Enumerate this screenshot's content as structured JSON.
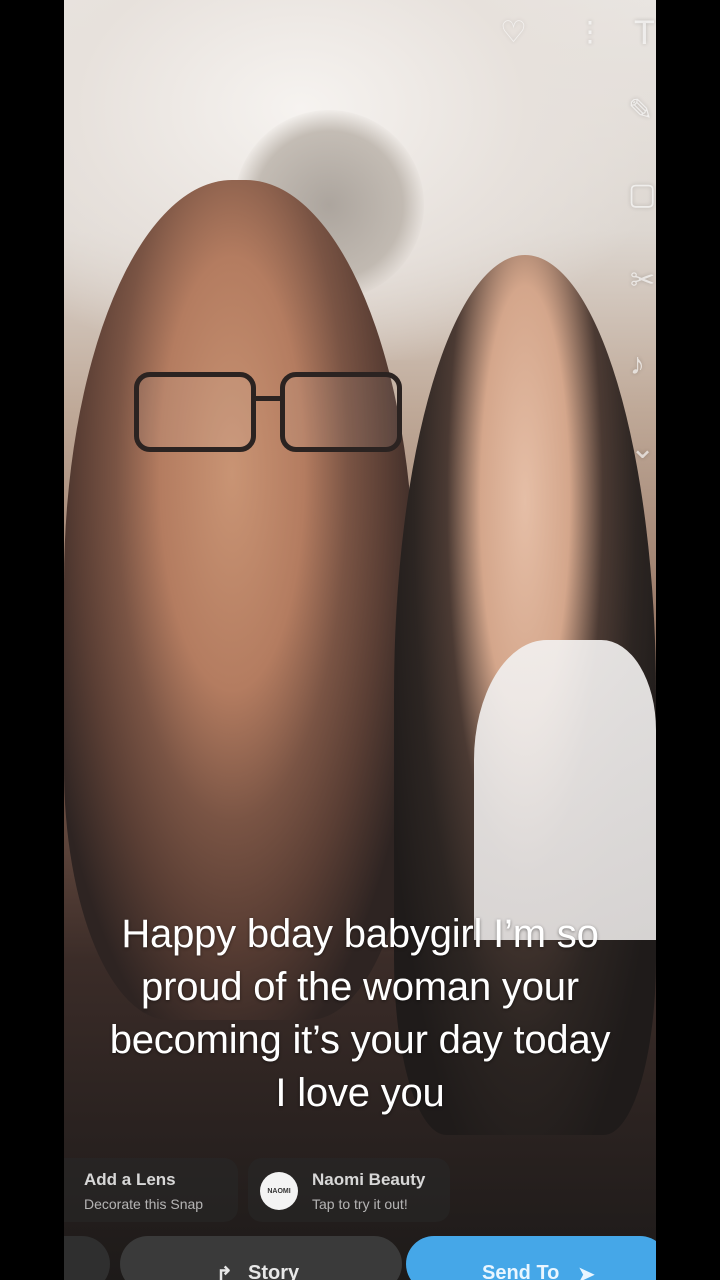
{
  "caption": {
    "line1": "Happy bday babygirl I’m so",
    "line2": "proud of the woman your",
    "line3": "becoming it’s your day today",
    "line4": "I love you"
  },
  "lens_chip": {
    "title": "Add a Lens",
    "subtitle": "Decorate this Snap"
  },
  "naomi_chip": {
    "logo": "NAOMI",
    "title": "Naomi Beauty",
    "subtitle": "Tap to try it out!"
  },
  "bottom_bar": {
    "story_label": "Story",
    "send_label": "Send To",
    "send_color": "#45a7e8"
  },
  "icons": {
    "heart": "heart-icon",
    "more": "more-vertical-icon",
    "text_tool": "text-tool-icon",
    "pencil": "pencil-icon",
    "sticker": "sticker-icon",
    "scissors": "scissors-icon",
    "music": "music-icon",
    "chevron": "chevron-down-icon",
    "story": "story-icon",
    "send": "send-arrow-icon"
  }
}
